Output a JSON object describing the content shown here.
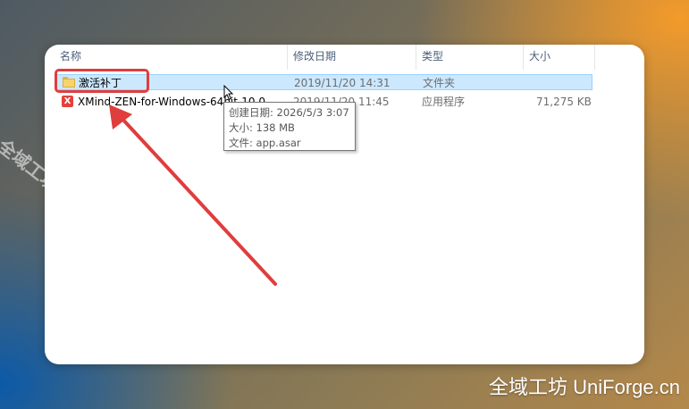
{
  "columns": {
    "name": "名称",
    "modified": "修改日期",
    "type": "类型",
    "size": "大小"
  },
  "files": [
    {
      "name": "激活补丁",
      "modified": "2019/11/20 14:31",
      "type": "文件夹",
      "size": "",
      "icon": "folder-icon",
      "selected": true
    },
    {
      "name": "XMind-ZEN-for-Windows-64bit-10.0",
      "modified": "2019/11/20 11:45",
      "type": "应用程序",
      "size": "71,275 KB",
      "icon": "xmind-app-icon",
      "selected": false
    }
  ],
  "tooltip": {
    "created": "创建日期: 2026/5/3 3:07",
    "size": "大小: 138 MB",
    "files": "文件: app.asar"
  },
  "watermark": {
    "diagonal": "全域工坊 UniForge.cn",
    "corner": "全域工坊 UniForge.cn"
  },
  "colors": {
    "annotation_red": "#e03d3d",
    "selection_bg": "#cce8ff",
    "selection_border": "#99d1ff"
  }
}
